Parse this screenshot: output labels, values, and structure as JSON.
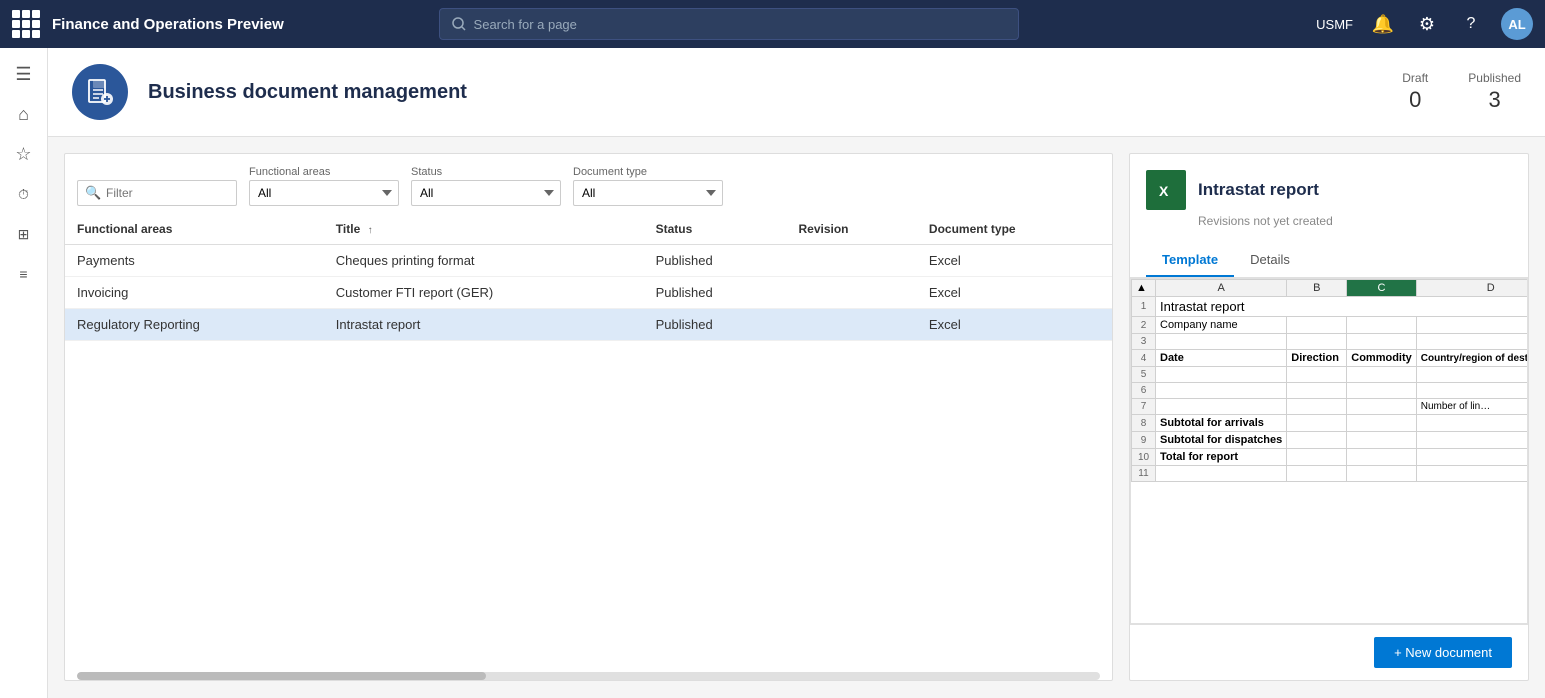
{
  "app": {
    "title": "Finance and Operations Preview",
    "user": "USMF",
    "avatar": "AL"
  },
  "search": {
    "placeholder": "Search for a page"
  },
  "page": {
    "title": "Business document management",
    "draft_label": "Draft",
    "draft_value": "0",
    "published_label": "Published",
    "published_value": "3"
  },
  "filters": {
    "filter_placeholder": "Filter",
    "functional_areas_label": "Functional areas",
    "functional_areas_value": "All",
    "status_label": "Status",
    "status_value": "All",
    "document_type_label": "Document type",
    "document_type_value": "All"
  },
  "table": {
    "columns": [
      "Functional areas",
      "Title",
      "Status",
      "Revision",
      "Document type"
    ],
    "title_sort": "Title ↑",
    "rows": [
      {
        "functional_area": "Payments",
        "title": "Cheques printing format",
        "status": "Published",
        "revision": "",
        "document_type": "Excel",
        "selected": false
      },
      {
        "functional_area": "Invoicing",
        "title": "Customer FTI report (GER)",
        "status": "Published",
        "revision": "",
        "document_type": "Excel",
        "selected": false
      },
      {
        "functional_area": "Regulatory Reporting",
        "title": "Intrastat report",
        "status": "Published",
        "revision": "",
        "document_type": "Excel",
        "selected": true
      }
    ]
  },
  "detail": {
    "title": "Intrastat report",
    "subtitle": "Revisions not yet created",
    "excel_icon": "X",
    "tab_template": "Template",
    "tab_details": "Details",
    "new_doc_btn": "+ New document",
    "excel_preview": {
      "columns": [
        "",
        "A",
        "B",
        "C",
        "D"
      ],
      "rows": [
        {
          "row": "1",
          "a": "Intrastat report",
          "a_bold": true,
          "b": "",
          "c": "",
          "d": ""
        },
        {
          "row": "2",
          "a": "Company name",
          "b": "",
          "c": "",
          "d": ""
        },
        {
          "row": "3",
          "a": "",
          "b": "",
          "c": "",
          "d": ""
        },
        {
          "row": "4",
          "a": "Date",
          "b": "Direction",
          "c": "Commodity",
          "d": "Country/region of destination",
          "a_bold": true
        },
        {
          "row": "5",
          "a": "",
          "b": "",
          "c": "",
          "d": ""
        },
        {
          "row": "6",
          "a": "",
          "b": "",
          "c": "",
          "d": ""
        },
        {
          "row": "7",
          "a": "",
          "b": "",
          "c": "",
          "d": "Number of lin…"
        },
        {
          "row": "8",
          "a": "Subtotal for arrivals",
          "a_bold": true,
          "b": "",
          "c": "",
          "d": ""
        },
        {
          "row": "9",
          "a": "Subtotal for dispatches",
          "a_bold": true,
          "b": "",
          "c": "",
          "d": ""
        },
        {
          "row": "10",
          "a": "Total for report",
          "a_bold": true,
          "b": "",
          "c": "",
          "d": ""
        },
        {
          "row": "11",
          "a": "",
          "b": "",
          "c": "",
          "d": ""
        }
      ]
    }
  },
  "sidebar": {
    "items": [
      {
        "icon": "☰",
        "name": "menu"
      },
      {
        "icon": "⌂",
        "name": "home"
      },
      {
        "icon": "★",
        "name": "favorites"
      },
      {
        "icon": "🕐",
        "name": "recent"
      },
      {
        "icon": "⊞",
        "name": "workspaces"
      },
      {
        "icon": "≡",
        "name": "modules"
      }
    ]
  }
}
